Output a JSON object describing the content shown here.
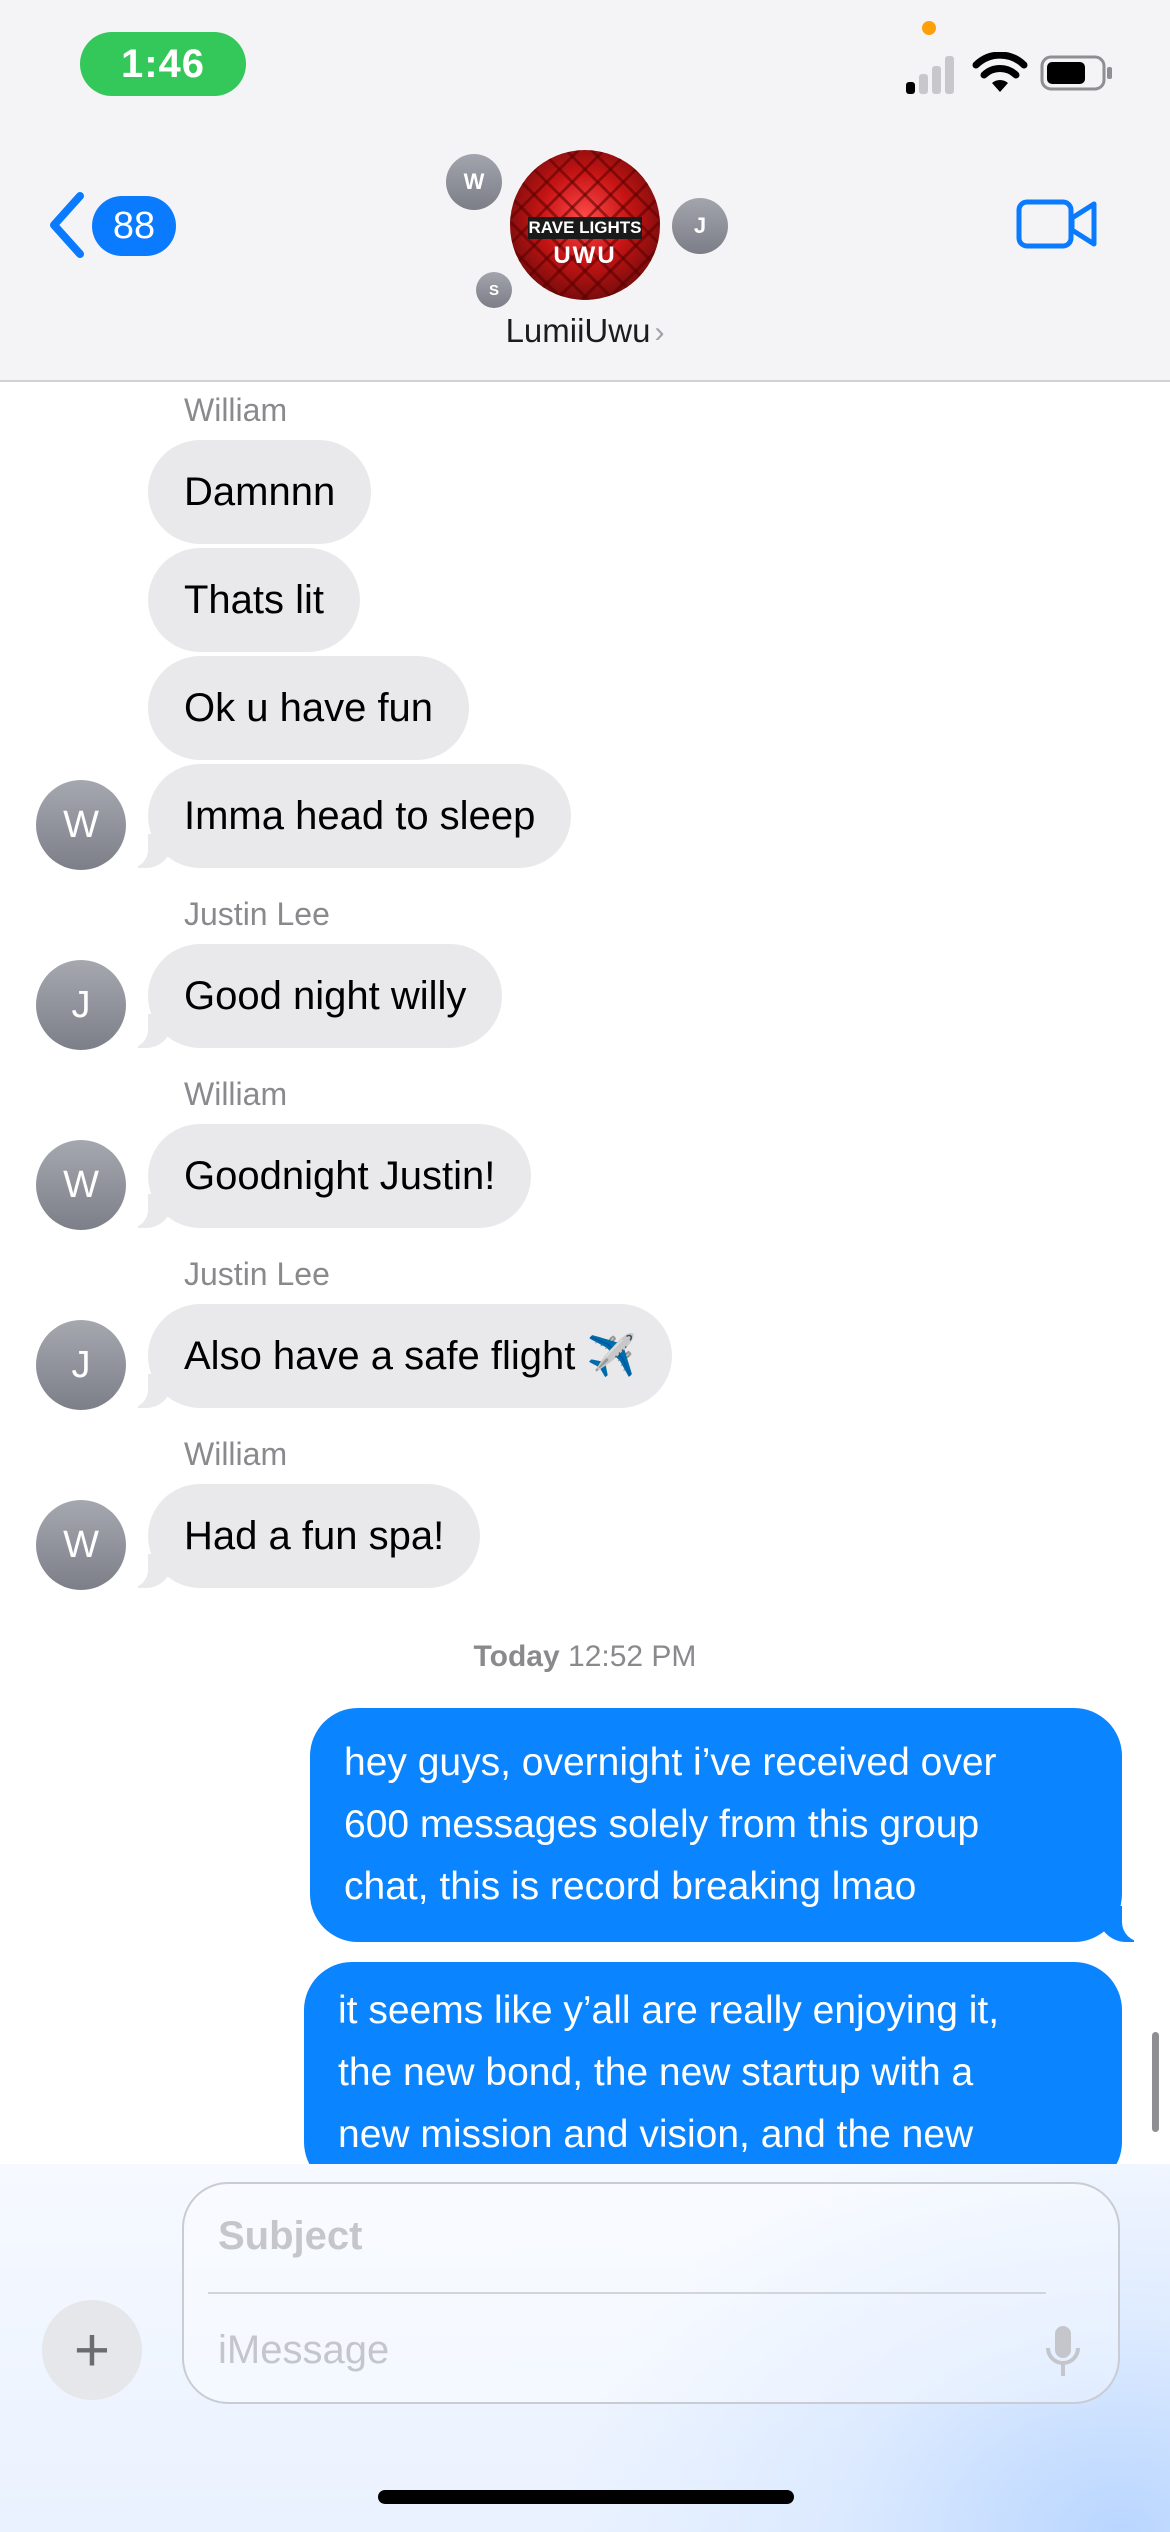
{
  "status_bar": {
    "time": "1:46"
  },
  "header": {
    "back_badge": "88",
    "group_name": "LumiiUwu",
    "group_photo_text": "RAVE LIGHTS UWU",
    "member_initials": [
      "W",
      "J",
      "S"
    ]
  },
  "messages": [
    {
      "sender": "William",
      "bubbles": [
        "Damnnn",
        "Thats lit",
        "Ok u have fun",
        "Imma head to sleep"
      ],
      "avatar": "W"
    },
    {
      "sender": "Justin Lee",
      "bubbles": [
        "Good night willy"
      ],
      "avatar": "J"
    },
    {
      "sender": "William",
      "bubbles": [
        "Goodnight Justin!"
      ],
      "avatar": "W"
    },
    {
      "sender": "Justin Lee",
      "bubbles": [
        "Also have a safe flight ✈️"
      ],
      "avatar": "J"
    },
    {
      "sender": "William",
      "bubbles": [
        "Had a fun spa!"
      ],
      "avatar": "W"
    }
  ],
  "timestamp": {
    "day": "Today",
    "time": "12:52 PM"
  },
  "outgoing": [
    "hey guys, overnight i’ve received over\n600 messages solely from this group\nchat, this is record breaking lmao",
    "it seems like y’all are really enjoying it,\nthe new bond, the new startup with a\nnew mission and vision, and the new"
  ],
  "compose": {
    "subject_placeholder": "Subject",
    "message_placeholder": "iMessage"
  },
  "colors": {
    "accent": "#0a84ff",
    "incoming_bubble": "#e9e9eb",
    "status_time_bg": "#34c759"
  }
}
